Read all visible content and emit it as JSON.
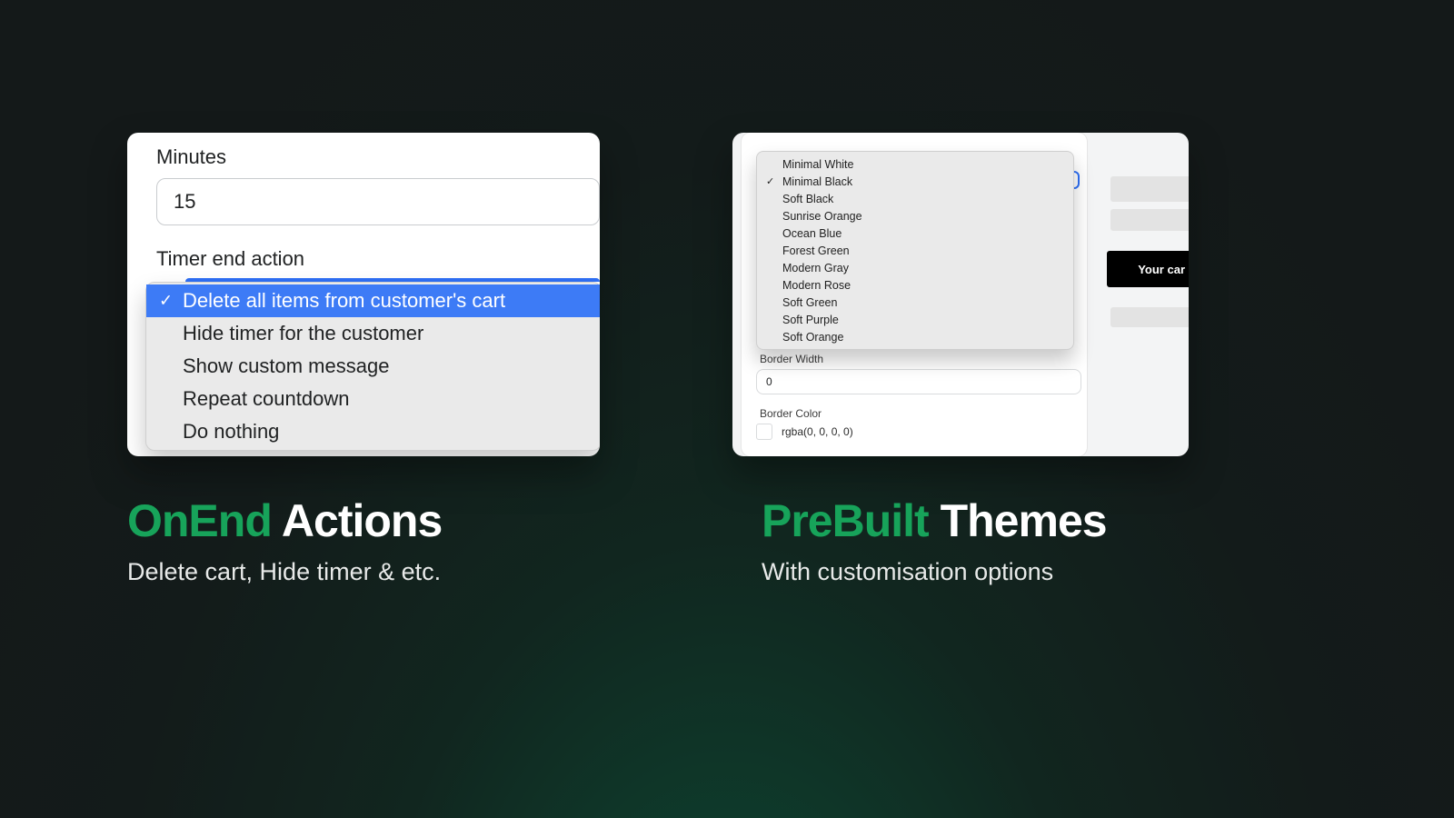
{
  "left": {
    "minutes_label": "Minutes",
    "minutes_value": "15",
    "timer_end_label": "Timer end action",
    "options": [
      "Delete all items from customer's cart",
      "Hide timer for the customer",
      "Show custom message",
      "Repeat countdown",
      "Do nothing"
    ],
    "selected_index": 0
  },
  "right": {
    "themes": [
      "Minimal White",
      "Minimal Black",
      "Soft Black",
      "Sunrise Orange",
      "Ocean Blue",
      "Forest Green",
      "Modern Gray",
      "Modern Rose",
      "Soft Green",
      "Soft Purple",
      "Soft Orange"
    ],
    "themes_selected_index": 1,
    "border_width_label": "Border Width",
    "border_width_value": "0",
    "border_color_label": "Border Color",
    "border_color_value": "rgba(0, 0, 0, 0)",
    "preview_label": "Your car"
  },
  "headlines": {
    "left_green": "OnEnd",
    "left_white": " Actions",
    "left_sub": "Delete cart, Hide timer & etc.",
    "right_green": "PreBuilt",
    "right_white": " Themes",
    "right_sub": "With customisation options"
  }
}
